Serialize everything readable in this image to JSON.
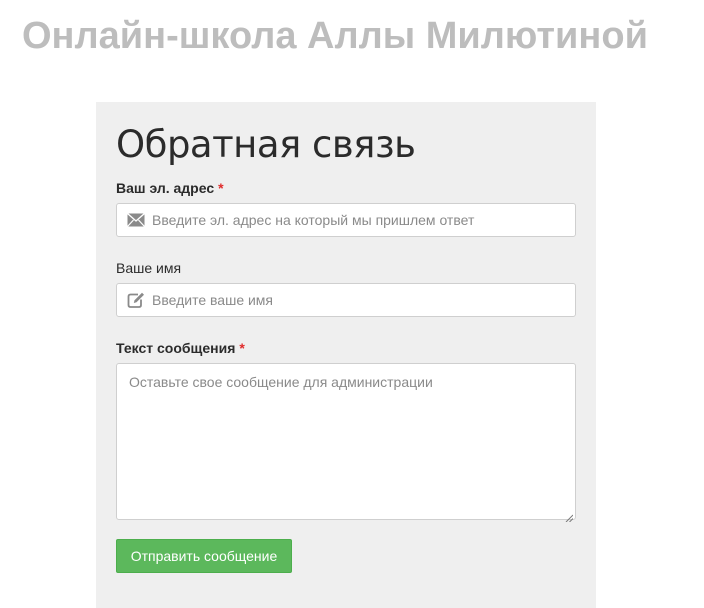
{
  "site": {
    "title": "Онлайн-школа Аллы Милютиной"
  },
  "form": {
    "heading": "Обратная связь",
    "email": {
      "label": "Ваш эл. адрес",
      "required_mark": "*",
      "placeholder": "Введите эл. адрес на который мы пришлем ответ",
      "icon": "envelope-icon"
    },
    "name": {
      "label": "Ваше имя",
      "placeholder": "Введите ваше имя",
      "icon": "edit-icon"
    },
    "message": {
      "label": "Текст сообщения",
      "required_mark": "*",
      "placeholder": "Оставьте свое сообщение для администрации"
    },
    "submit_label": "Отправить сообщение"
  },
  "colors": {
    "title": "#bdbdbd",
    "panel_background": "#efefef",
    "required": "#e02b2b",
    "submit_background": "#5cb85c"
  }
}
